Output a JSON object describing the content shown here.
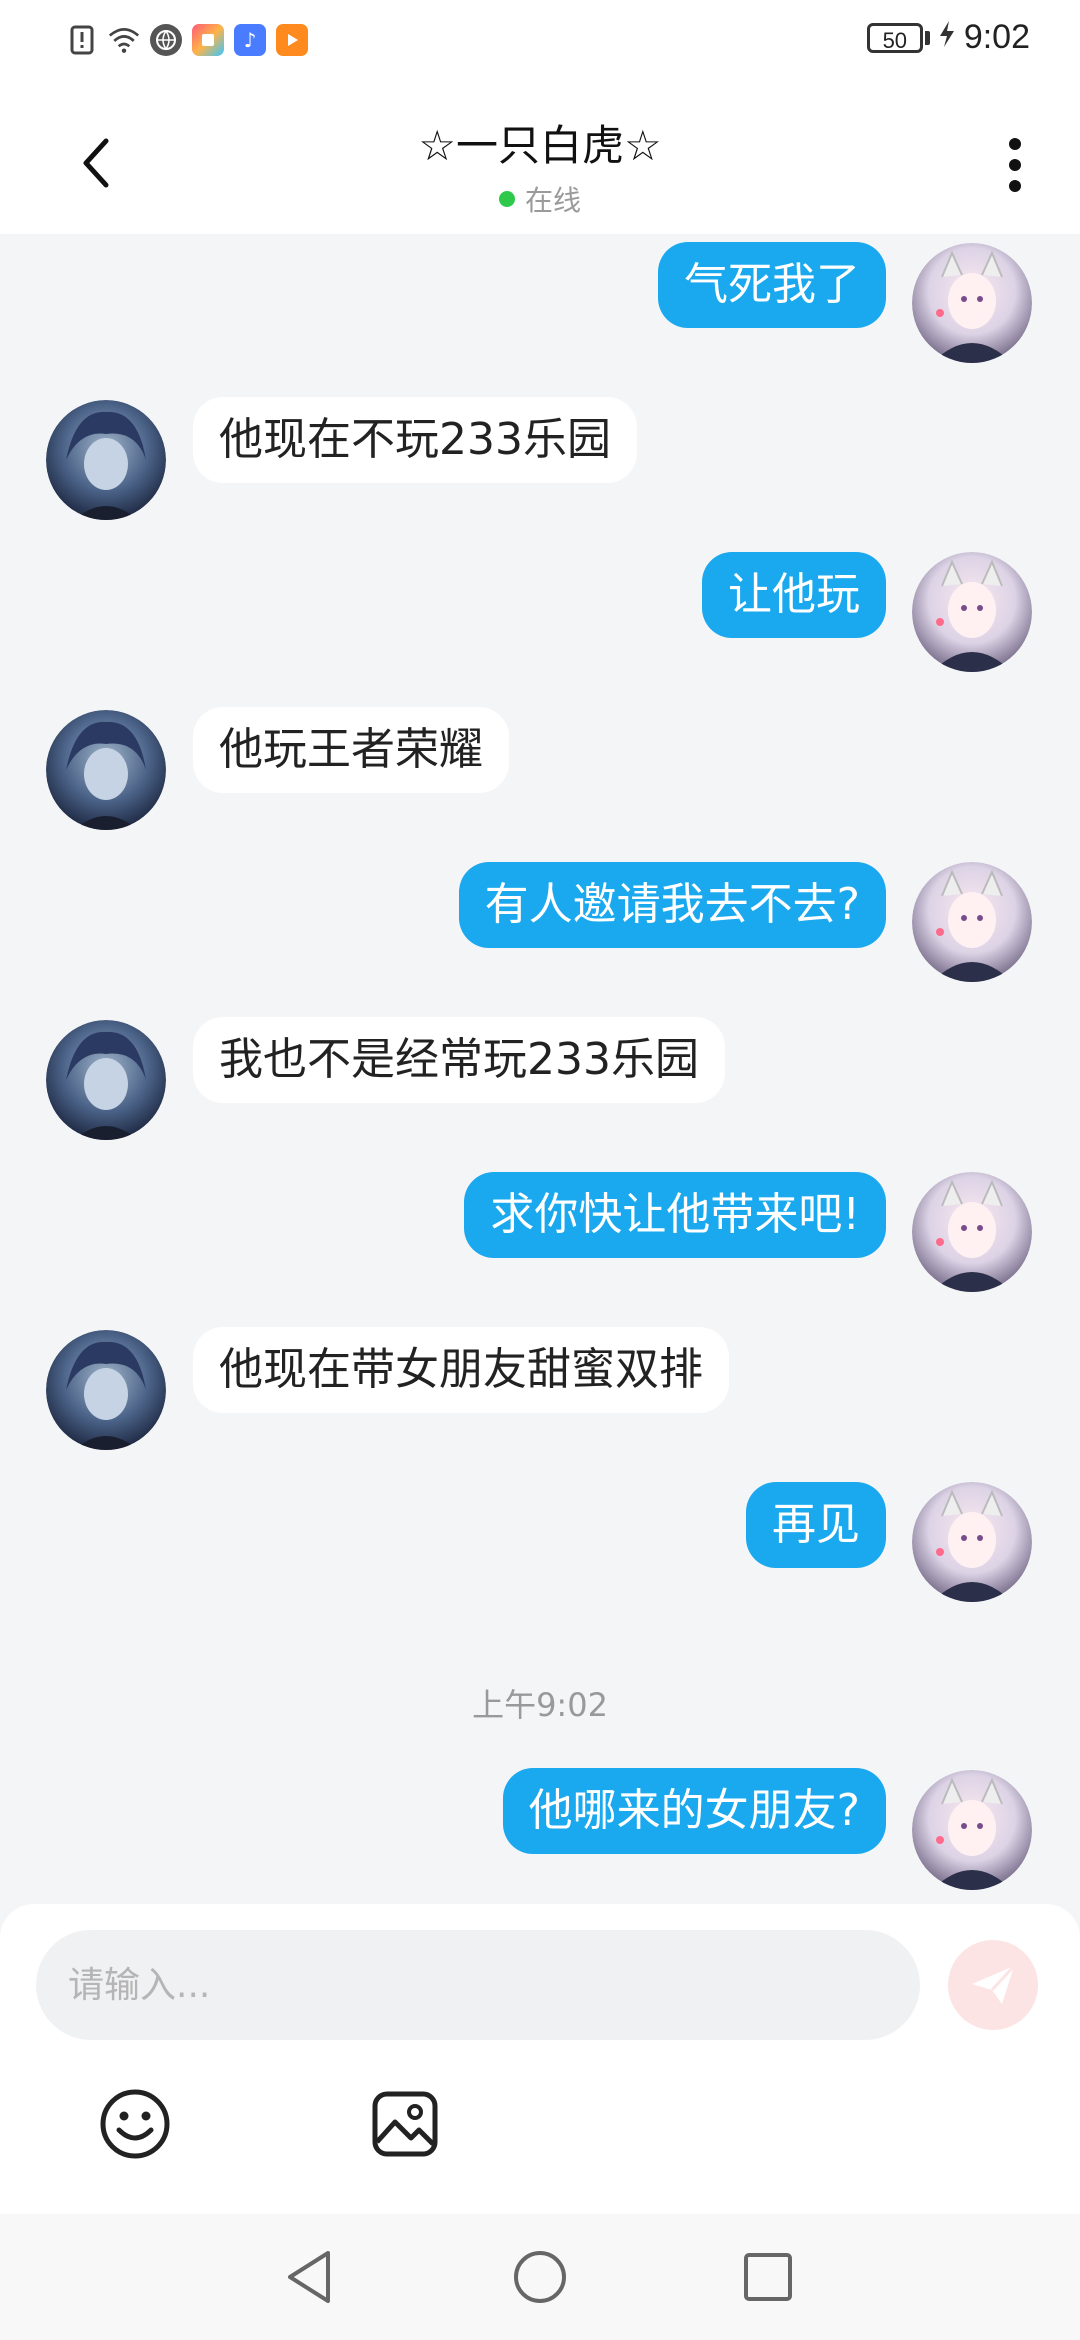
{
  "status_bar": {
    "battery": "50",
    "time": "9:02"
  },
  "header": {
    "title": "☆一只白虎☆",
    "presence": "在线",
    "presence_color": "#2ec84a"
  },
  "messages": [
    {
      "side": "out",
      "text": "气死我了"
    },
    {
      "side": "in",
      "text": "他现在不玩233乐园"
    },
    {
      "side": "out",
      "text": "让他玩"
    },
    {
      "side": "in",
      "text": "他玩王者荣耀"
    },
    {
      "side": "out",
      "text": "有人邀请我去不去?"
    },
    {
      "side": "in",
      "text": "我也不是经常玩233乐园"
    },
    {
      "side": "out",
      "text": "求你快让他带来吧!"
    },
    {
      "side": "in",
      "text": "他现在带女朋友甜蜜双排"
    },
    {
      "side": "out",
      "text": "再见"
    },
    {
      "side": "timestamp",
      "text": "上午9:02"
    },
    {
      "side": "out",
      "text": "他哪来的女朋友?"
    }
  ],
  "composer": {
    "placeholder": "请输入...",
    "value": ""
  },
  "colors": {
    "outgoing_bubble": "#1aa8ee",
    "incoming_bubble": "#ffffff",
    "background": "#f4f5f7"
  },
  "icons": {
    "back": "chevron-left-icon",
    "more": "more-vertical-icon",
    "send": "send-icon",
    "emoji": "emoji-icon",
    "image": "image-icon"
  }
}
